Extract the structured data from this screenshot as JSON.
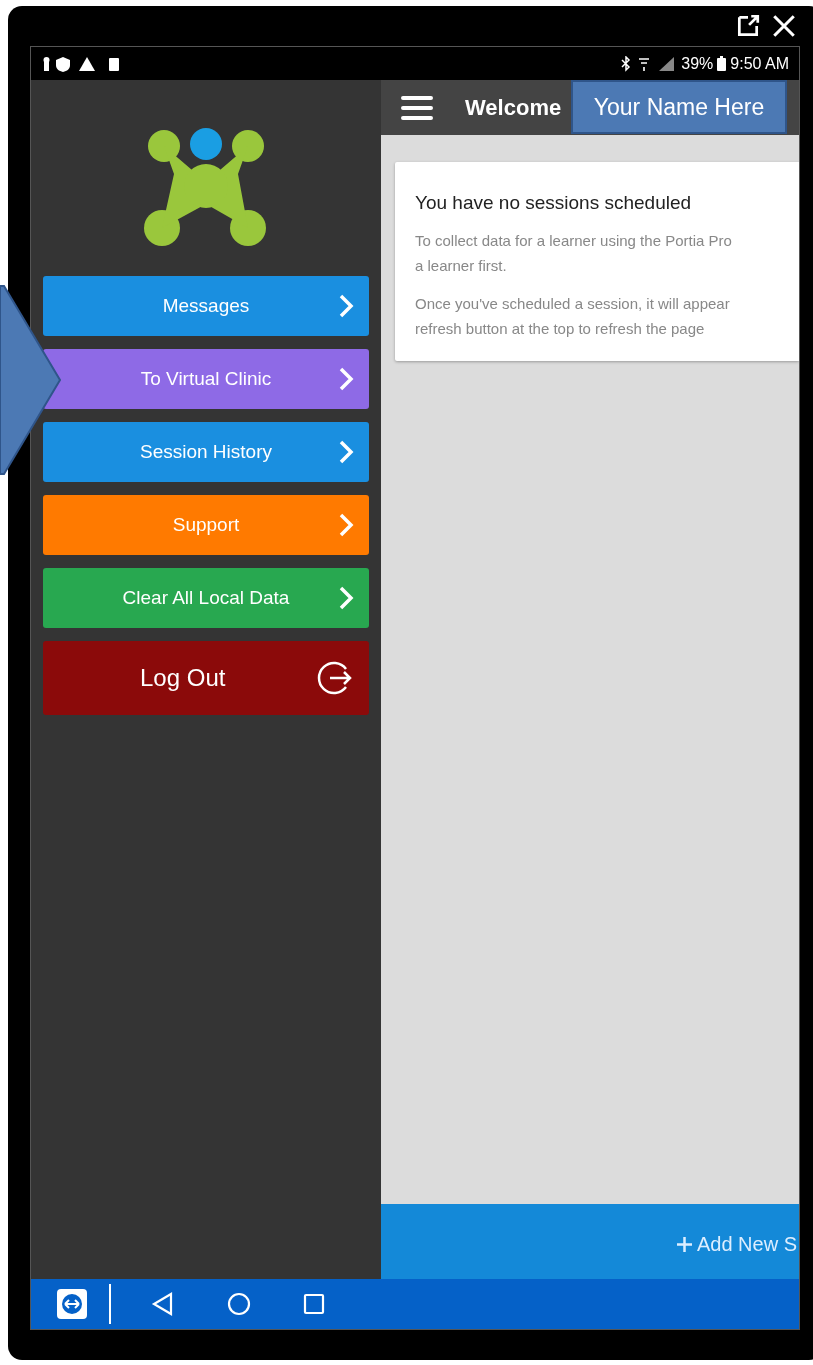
{
  "status_bar": {
    "battery": "39%",
    "time": "9:50 AM"
  },
  "header": {
    "title": "Welcome",
    "annotation": "Your Name Here"
  },
  "menu": [
    {
      "label": "Messages",
      "kind": "arrow",
      "color": "#1a8fe0"
    },
    {
      "label": "To Virtual Clinic",
      "kind": "arrow",
      "color": "#8e6ae6"
    },
    {
      "label": "Session History",
      "kind": "arrow",
      "color": "#1a8fe0"
    },
    {
      "label": "Support",
      "kind": "arrow",
      "color": "#ff7a00"
    },
    {
      "label": "Clear All Local Data",
      "kind": "arrow",
      "color": "#28a850"
    },
    {
      "label": "Log Out",
      "kind": "logout",
      "color": "#8b0a0a"
    }
  ],
  "card": {
    "title": "You have no sessions scheduled",
    "paragraphs": [
      [
        "To collect data for a learner using the Portia Pro",
        "a learner first."
      ],
      [
        "Once you've scheduled a session, it will appear",
        "refresh button at the top to refresh the page"
      ]
    ]
  },
  "bottom_bar": {
    "action": "Add New S"
  }
}
